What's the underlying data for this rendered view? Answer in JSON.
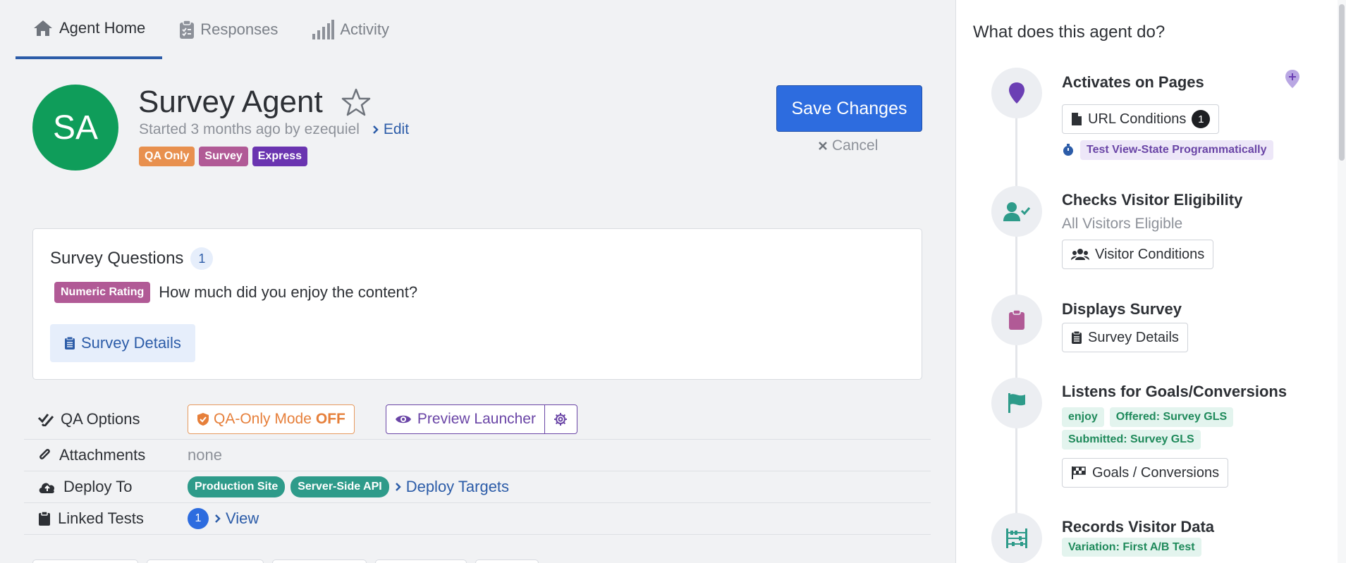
{
  "tabs": [
    {
      "label": "Agent Home",
      "icon": "home-icon",
      "active": true
    },
    {
      "label": "Responses",
      "icon": "clipboard-icon",
      "active": false
    },
    {
      "label": "Activity",
      "icon": "signal-bars-icon",
      "active": false
    }
  ],
  "agent": {
    "initials": "SA",
    "name": "Survey Agent",
    "started": "Started 3 months ago by ezequiel",
    "edit_label": "Edit",
    "badges": [
      {
        "label": "QA Only",
        "color": "#e8904e"
      },
      {
        "label": "Survey",
        "color": "#b15a96"
      },
      {
        "label": "Express",
        "color": "#6a34b0"
      }
    ]
  },
  "actions": {
    "save_label": "Save Changes",
    "cancel_label": "Cancel"
  },
  "survey_questions": {
    "title": "Survey Questions",
    "count": "1",
    "questions": [
      {
        "type": "Numeric Rating",
        "text": "How much did you enjoy the content?"
      }
    ],
    "details_label": "Survey Details"
  },
  "info_rows": {
    "qa_options": {
      "label": "QA Options",
      "mode_label": "QA-Only Mode",
      "mode_state": "OFF",
      "preview_label": "Preview Launcher"
    },
    "attachments": {
      "label": "Attachments",
      "value": "none"
    },
    "deploy_to": {
      "label": "Deploy To",
      "targets": [
        "Production Site",
        "Server-Side API"
      ],
      "link_label": "Deploy Targets"
    },
    "linked_tests": {
      "label": "Linked Tests",
      "count": "1",
      "link_label": "View"
    }
  },
  "sidebar": {
    "title": "What does this agent do?",
    "steps": {
      "activates": {
        "title": "Activates on Pages",
        "button_label": "URL Conditions",
        "count": "1",
        "tag": "Test View-State Programmatically"
      },
      "eligibility": {
        "title": "Checks Visitor Eligibility",
        "subtitle": "All Visitors Eligible",
        "button_label": "Visitor Conditions"
      },
      "displays": {
        "title": "Displays Survey",
        "button_label": "Survey Details"
      },
      "goals": {
        "title": "Listens for Goals/Conversions",
        "tags": [
          "enjoy",
          "Offered: Survey GLS",
          "Submitted: Survey GLS"
        ],
        "button_label": "Goals / Conversions"
      },
      "records": {
        "title": "Records Visitor Data",
        "tag": "Variation: First A/B Test"
      }
    }
  }
}
